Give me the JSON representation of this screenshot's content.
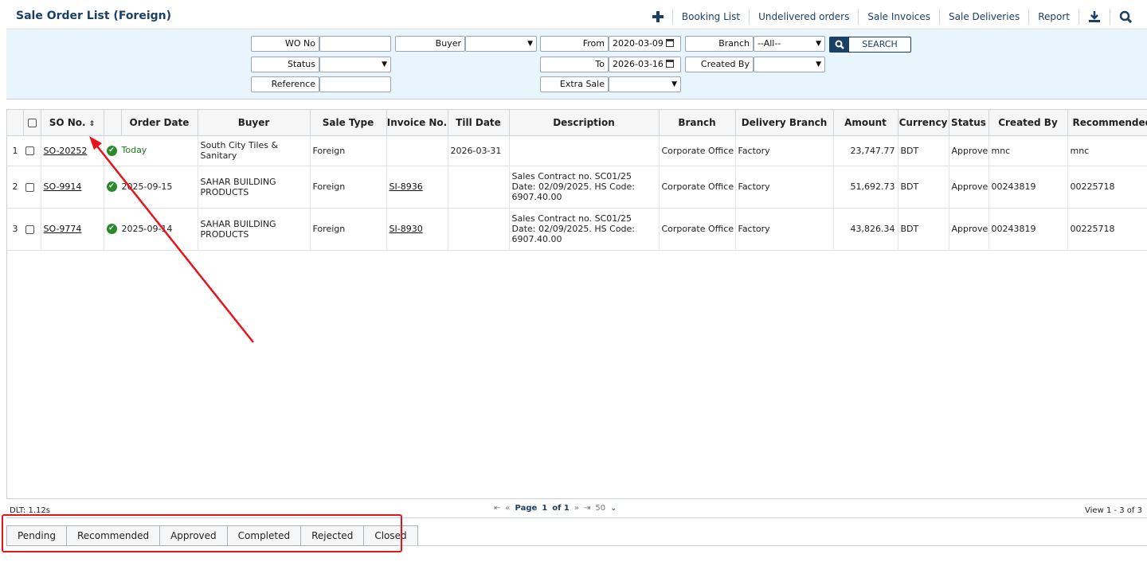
{
  "title": "Sale Order List (Foreign)",
  "topnav": {
    "booking_list": "Booking List",
    "undelivered_orders": "Undelivered orders",
    "sale_invoices": "Sale Invoices",
    "sale_deliveries": "Sale Deliveries",
    "report": "Report"
  },
  "filters": {
    "wo_no": "WO No",
    "buyer": "Buyer",
    "from": "From",
    "from_value": "2020-03-09",
    "branch": "Branch",
    "branch_value": "--All--",
    "search": "SEARCH",
    "status": "Status",
    "to": "To",
    "to_value": "2026-03-16",
    "created_by": "Created By",
    "reference": "Reference",
    "extra_sale": "Extra Sale"
  },
  "table": {
    "columns": {
      "so_no": "SO No.",
      "order_date": "Order Date",
      "buyer": "Buyer",
      "sale_type": "Sale Type",
      "invoice_no": "Invoice No.",
      "till_date": "Till Date",
      "description": "Description",
      "branch": "Branch",
      "delivery_branch": "Delivery Branch",
      "amount": "Amount",
      "currency": "Currency",
      "status": "Status",
      "created_by": "Created By",
      "recommended": "Recommended"
    },
    "rows": [
      {
        "n": "1",
        "so": "SO-20252",
        "date": "Today",
        "buyer": "South City Tiles & Sanitary",
        "type": "Foreign",
        "invoice": "",
        "till": "2026-03-31",
        "desc": "",
        "branch": "Corporate Office",
        "dbranch": "Factory",
        "amount": "23,747.77",
        "currency": "BDT",
        "status": "Approved",
        "created": "mnc",
        "rec": "mnc"
      },
      {
        "n": "2",
        "so": "SO-9914",
        "date": "2025-09-15",
        "buyer": "SAHAR BUILDING PRODUCTS",
        "type": "Foreign",
        "invoice": "SI-8936",
        "till": "",
        "desc": "Sales Contract no. SC01/25 Date: 02/09/2025. HS Code: 6907.40.00",
        "branch": "Corporate Office",
        "dbranch": "Factory",
        "amount": "51,692.73",
        "currency": "BDT",
        "status": "Approved",
        "created": "00243819",
        "rec": "00225718"
      },
      {
        "n": "3",
        "so": "SO-9774",
        "date": "2025-09-14",
        "buyer": "SAHAR BUILDING PRODUCTS",
        "type": "Foreign",
        "invoice": "SI-8930",
        "till": "",
        "desc": "Sales Contract no. SC01/25 Date: 02/09/2025. HS Code: 6907.40.00",
        "branch": "Corporate Office",
        "dbranch": "Factory",
        "amount": "43,826.34",
        "currency": "BDT",
        "status": "Approved",
        "created": "00243819",
        "rec": "00225718"
      }
    ]
  },
  "pager": {
    "dlt": "DLT: 1.12s",
    "page_label": "Page",
    "page": "1",
    "of": "of 1",
    "per_page": "50",
    "view": "View 1 - 3 of 3"
  },
  "status_tabs": [
    "Pending",
    "Recommended",
    "Approved",
    "Completed",
    "Rejected",
    "Closed"
  ],
  "colors": {
    "annotation": "#e8141a",
    "accent": "#1c3f66",
    "filter_bg": "#e8f5fd"
  }
}
